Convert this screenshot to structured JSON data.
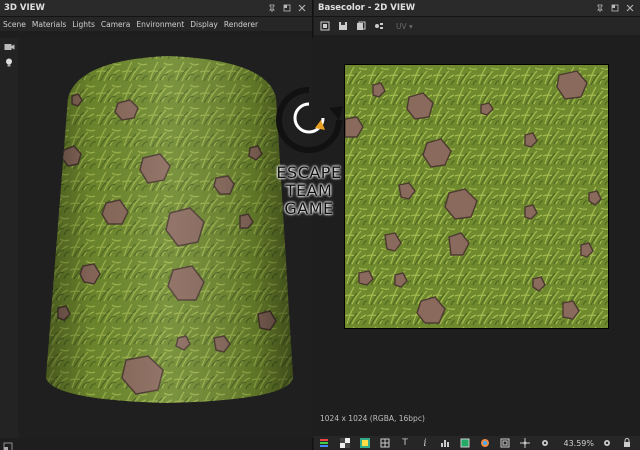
{
  "left_panel": {
    "title": "3D VIEW",
    "menu": [
      "Scene",
      "Materials",
      "Lights",
      "Camera",
      "Environment",
      "Display",
      "Renderer"
    ]
  },
  "right_panel": {
    "title": "Basecolor - 2D VIEW",
    "uv_label": "UV",
    "status": "1024 x 1024 (RGBA, 16bpc)",
    "zoom": "43.59%"
  },
  "watermark": {
    "line1": "ESCAPE",
    "line2": "TEAM",
    "line3": "GAME"
  },
  "colors": {
    "grass": "#6f8a2e",
    "grass_dark": "#4f6a1f",
    "rock": "#8a6a5c",
    "panel_bg": "#1e1e1e"
  }
}
